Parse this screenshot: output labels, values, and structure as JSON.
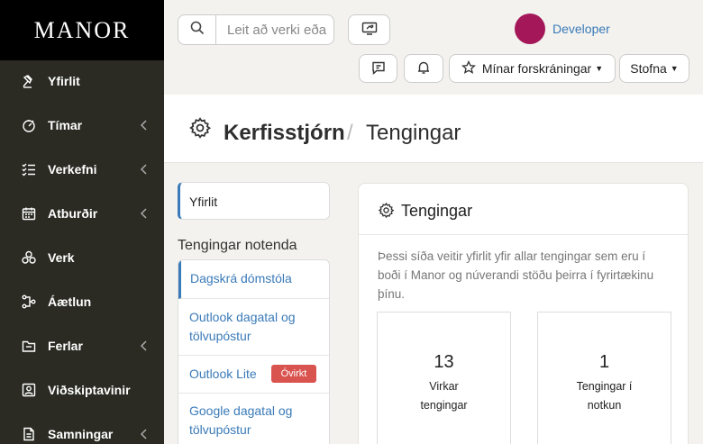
{
  "brand": {
    "logo": "MANOR"
  },
  "sidebar": {
    "items": [
      {
        "label": "Yfirlit",
        "icon": "gavel-icon",
        "chevron": false
      },
      {
        "label": "Tímar",
        "icon": "timer-icon",
        "chevron": true
      },
      {
        "label": "Verkefni",
        "icon": "task-list-icon",
        "chevron": true
      },
      {
        "label": "Atburðir",
        "icon": "calendar-icon",
        "chevron": true
      },
      {
        "label": "Verk",
        "icon": "cluster-icon",
        "chevron": false
      },
      {
        "label": "Áætlun",
        "icon": "plan-icon",
        "chevron": false
      },
      {
        "label": "Ferlar",
        "icon": "folder-icon",
        "chevron": true
      },
      {
        "label": "Viðskiptavinir",
        "icon": "contacts-icon",
        "chevron": false
      },
      {
        "label": "Samningar",
        "icon": "document-icon",
        "chevron": true
      }
    ]
  },
  "topbar": {
    "search_placeholder": "Leit að verki eða",
    "user_name": "Developer",
    "registrations_label": "Mínar forskráningar",
    "create_label": "Stofna"
  },
  "page": {
    "breadcrumb_main": "Kerfisstjórn",
    "breadcrumb_sep": "/",
    "breadcrumb_sub": "Tengingar"
  },
  "subnav": {
    "overview_label": "Yfirlit",
    "group_title": "Tengingar notenda",
    "items": [
      {
        "label": "Dagskrá dómstóla"
      },
      {
        "label": "Outlook dagatal og tölvupóstur"
      },
      {
        "label": "Outlook Lite",
        "badge": "Óvirkt"
      },
      {
        "label": "Google dagatal og tölvupóstur"
      }
    ]
  },
  "card": {
    "title": "Tengingar",
    "description": "Þessi síða veitir yfirlit yfir allar tengingar sem eru í boði í Manor og núverandi stöðu þeirra í fyrirtækinu þínu.",
    "stats": [
      {
        "value": "13",
        "label": "Virkar tengingar"
      },
      {
        "value": "1",
        "label": "Tengingar í notkun"
      }
    ]
  },
  "colors": {
    "sidebar_bg": "#2b2b24",
    "accent": "#3a7ab8",
    "avatar": "#a4185a",
    "badge": "#d9534f"
  }
}
